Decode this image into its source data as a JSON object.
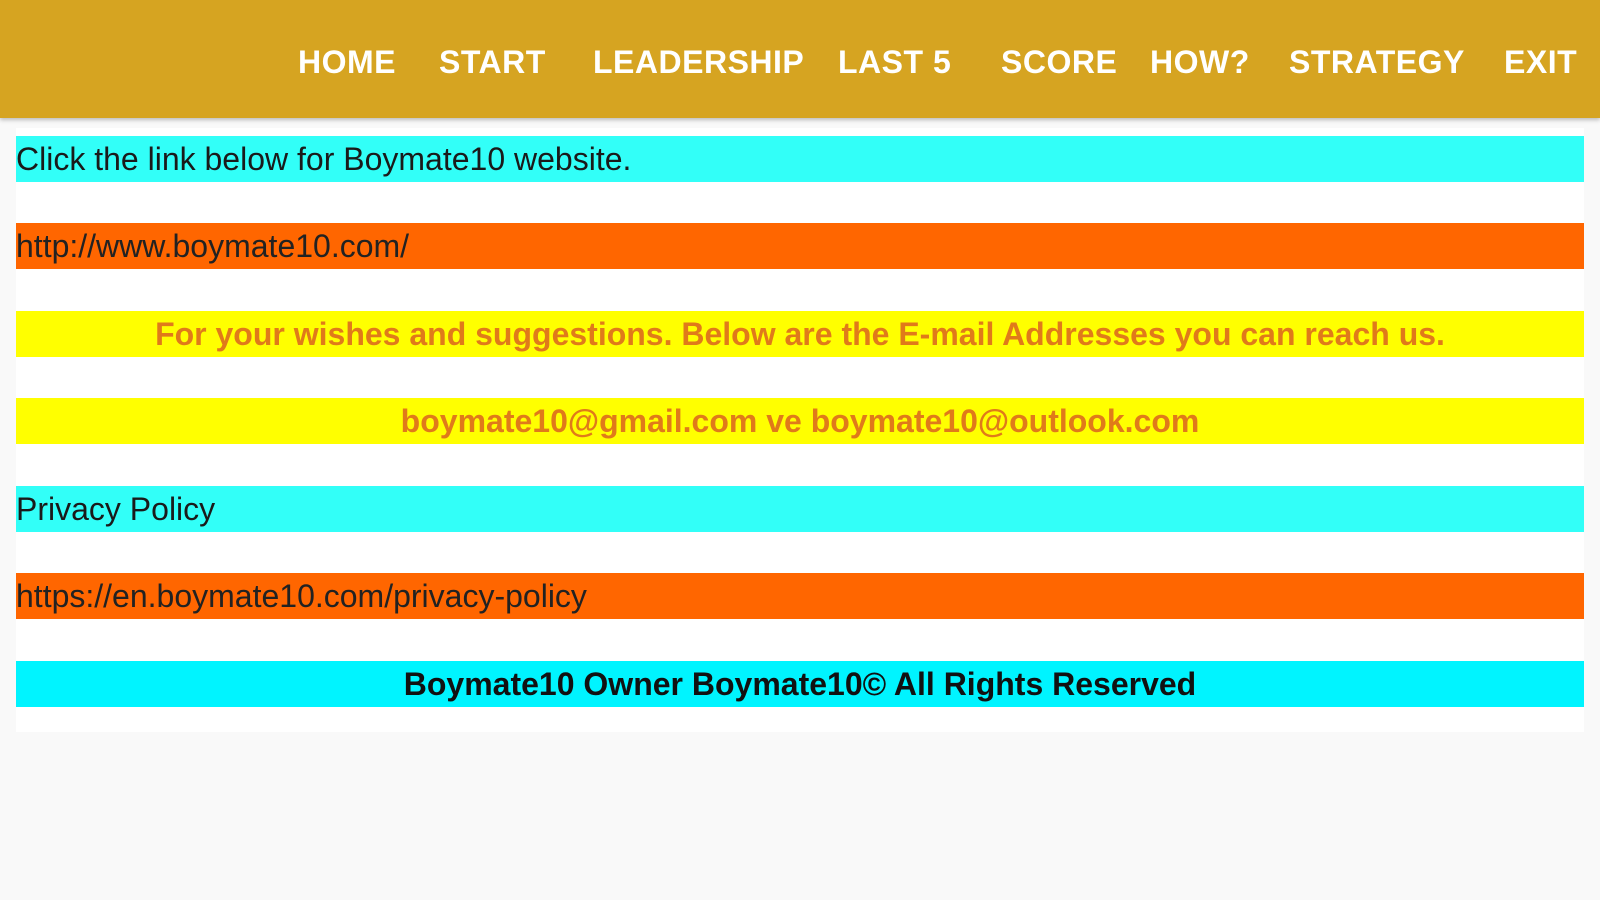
{
  "nav": {
    "home": "HOME",
    "start": "START",
    "leadership": "LEADERSHIP",
    "last5": "LAST 5",
    "score": "SCORE",
    "how": "HOW?",
    "strategy": "STRATEGY",
    "exit": "EXIT"
  },
  "content": {
    "website_prompt": "Click the link below for Boymate10 website.",
    "website_url": "http://www.boymate10.com/",
    "suggestions_text": "For your wishes and suggestions. Below are the E-mail Addresses you can reach us.",
    "emails": "boymate10@gmail.com ve boymate10@outlook.com",
    "privacy_label": "Privacy Policy",
    "privacy_url": "https://en.boymate10.com/privacy-policy",
    "copyright": "Boymate10 Owner Boymate10© All Rights Reserved"
  },
  "colors": {
    "topbar": "#d6a421",
    "cyan": "#32fff8",
    "orange": "#ff6600",
    "yellow": "#ffff00",
    "yellow_text": "#e07a1a"
  }
}
